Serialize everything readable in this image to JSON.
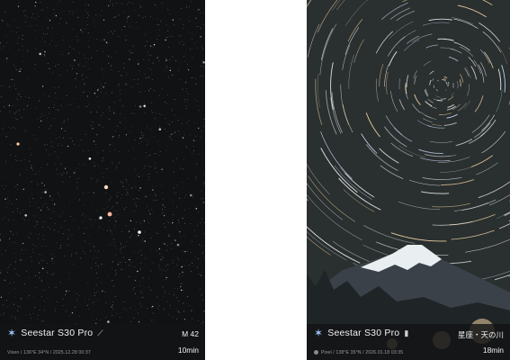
{
  "left_card": {
    "brand": "Seestar S30 Pro",
    "target": "M 42",
    "duration": "10min",
    "meta": "Vixen / 136°E 34°N / 2025.12.28 00:37"
  },
  "right_card": {
    "brand": "Seestar S30 Pro",
    "target": "星座・天の川",
    "duration": "18min",
    "meta": "Pixel / 138°E 35°N / 2026.01.18 03:35"
  },
  "colors": {
    "left_sky": "#111214",
    "right_sky": "#2a2f2f",
    "info_bar": "#121416",
    "snow": "#e9eef0",
    "mountain": "#3a4148"
  },
  "icons": [
    "seestar-star-icon",
    "telescope-icon",
    "location-dot-icon"
  ]
}
